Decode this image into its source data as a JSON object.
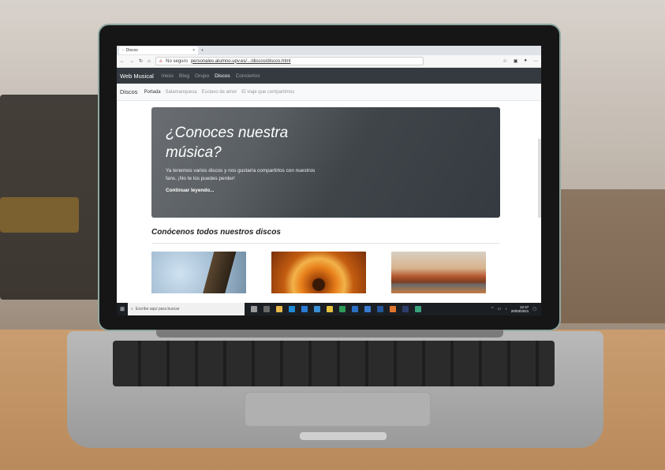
{
  "browser": {
    "tab_title": "Discos",
    "tab_close": "×",
    "address_warning": "No seguro",
    "url": "personales.alumno.upv.es/.../discos/discos.html"
  },
  "site": {
    "brand": "Web Musical",
    "nav": [
      "Inicio",
      "Blog",
      "Grupo",
      "Discos",
      "Conciertos"
    ],
    "subnav_brand": "Discos",
    "subnav": [
      "Portada",
      "Salamanquesa",
      "Esclavo de amor",
      "El viaje que compartimos"
    ]
  },
  "hero": {
    "title": "¿Conoces nuestra música?",
    "text": "Ya tenemos varios discos y nos gustaría compartirlos con nuestros fans. ¡No te los puedes perder!",
    "link": "Continuar leyendo..."
  },
  "section": {
    "title": "Conócenos todos nuestros discos"
  },
  "taskbar": {
    "search_placeholder": "Escribe aquí para buscar",
    "time": "12:47",
    "date": "20/03/2021"
  },
  "colors": {
    "navbar": "#343a40",
    "hero_bg": "#343a40",
    "lid": "#161616"
  }
}
